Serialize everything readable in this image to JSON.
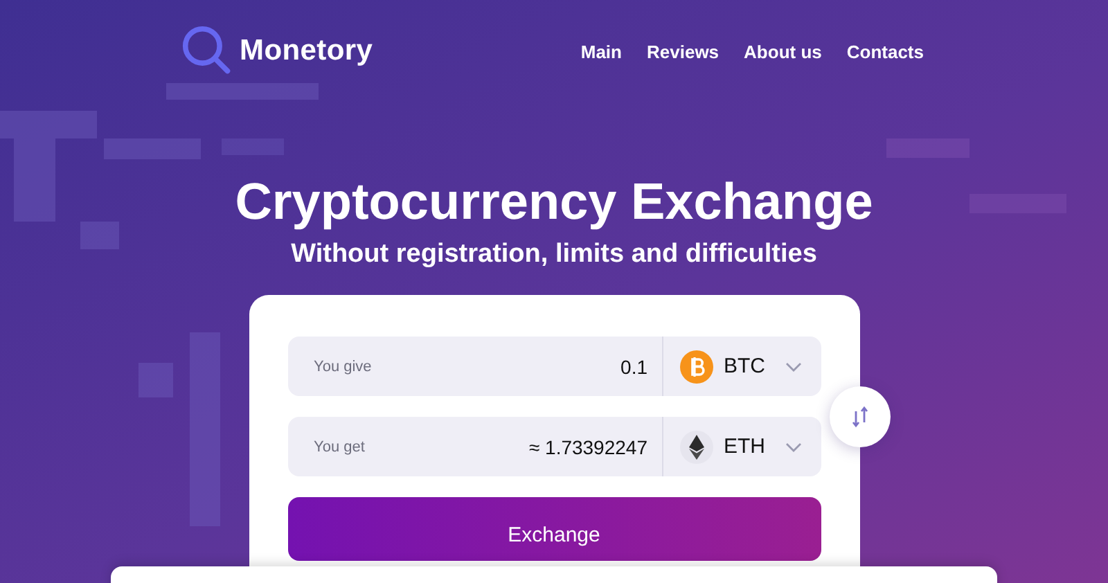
{
  "header": {
    "logo": "Monetory",
    "nav": [
      "Main",
      "Reviews",
      "About us",
      "Contacts"
    ]
  },
  "hero": {
    "title": "Cryptocurrency Exchange",
    "subtitle": "Without registration, limits and difficulties"
  },
  "exchange": {
    "rows": [
      {
        "label": "You give",
        "value": "0.1",
        "currency": "BTC",
        "kind": "orange-coin"
      },
      {
        "label": "You get",
        "value": "≈ 1.73392247",
        "currency": "ETH",
        "kind": "diamond-coin"
      }
    ],
    "button": "Exchange"
  }
}
